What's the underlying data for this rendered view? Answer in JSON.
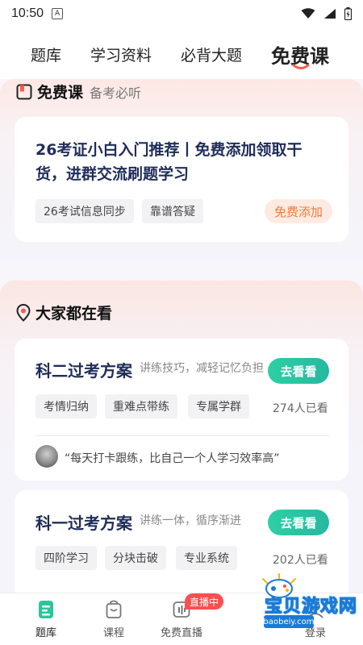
{
  "status_bar": {
    "time": "10:50",
    "notification_icon": "A"
  },
  "top_tabs": [
    {
      "label": "题库",
      "active": false
    },
    {
      "label": "学习资料",
      "active": false
    },
    {
      "label": "必背大题",
      "active": false
    },
    {
      "label": "免费课",
      "active": true
    }
  ],
  "free_course": {
    "title": "免费课",
    "subtitle": "备考必听",
    "card": {
      "title": "26考证小白入门推荐丨免费添加领取干货，进群交流刷题学习",
      "tags": [
        "26考试信息同步",
        "靠谱答疑"
      ],
      "action": "免费添加"
    }
  },
  "popular": {
    "title": "大家都在看",
    "courses": [
      {
        "title": "科二过考方案",
        "desc": "讲练技巧，减轻记忆负担",
        "button": "去看看",
        "tags": [
          "考情归纳",
          "重难点带练",
          "专属学群"
        ],
        "viewers": "274人已看",
        "quote": "“每天打卡跟练，比自己一个人学习效率高”"
      },
      {
        "title": "科一过考方案",
        "desc": "讲练一体，循序渐进",
        "button": "去看看",
        "tags": [
          "四阶学习",
          "分块击破",
          "专业系统"
        ],
        "viewers": "202人已看"
      }
    ]
  },
  "bottom_nav": {
    "items": [
      {
        "label": "题库",
        "icon": "question-bank-icon",
        "active": true
      },
      {
        "label": "课程",
        "icon": "course-bag-icon",
        "active": false
      },
      {
        "label": "免费直播",
        "icon": "live-icon",
        "active": false
      },
      {
        "label": "登录",
        "icon": "user-icon",
        "active": false
      }
    ],
    "live_badge": "直播中"
  },
  "watermark": {
    "text": "宝贝游戏网",
    "url": "baobeiy.com"
  },
  "colors": {
    "accent_green": "#2cd0a5",
    "accent_orange": "#f07a3d",
    "title_navy": "#1f2d5a",
    "badge_red": "#ff4d4f"
  }
}
